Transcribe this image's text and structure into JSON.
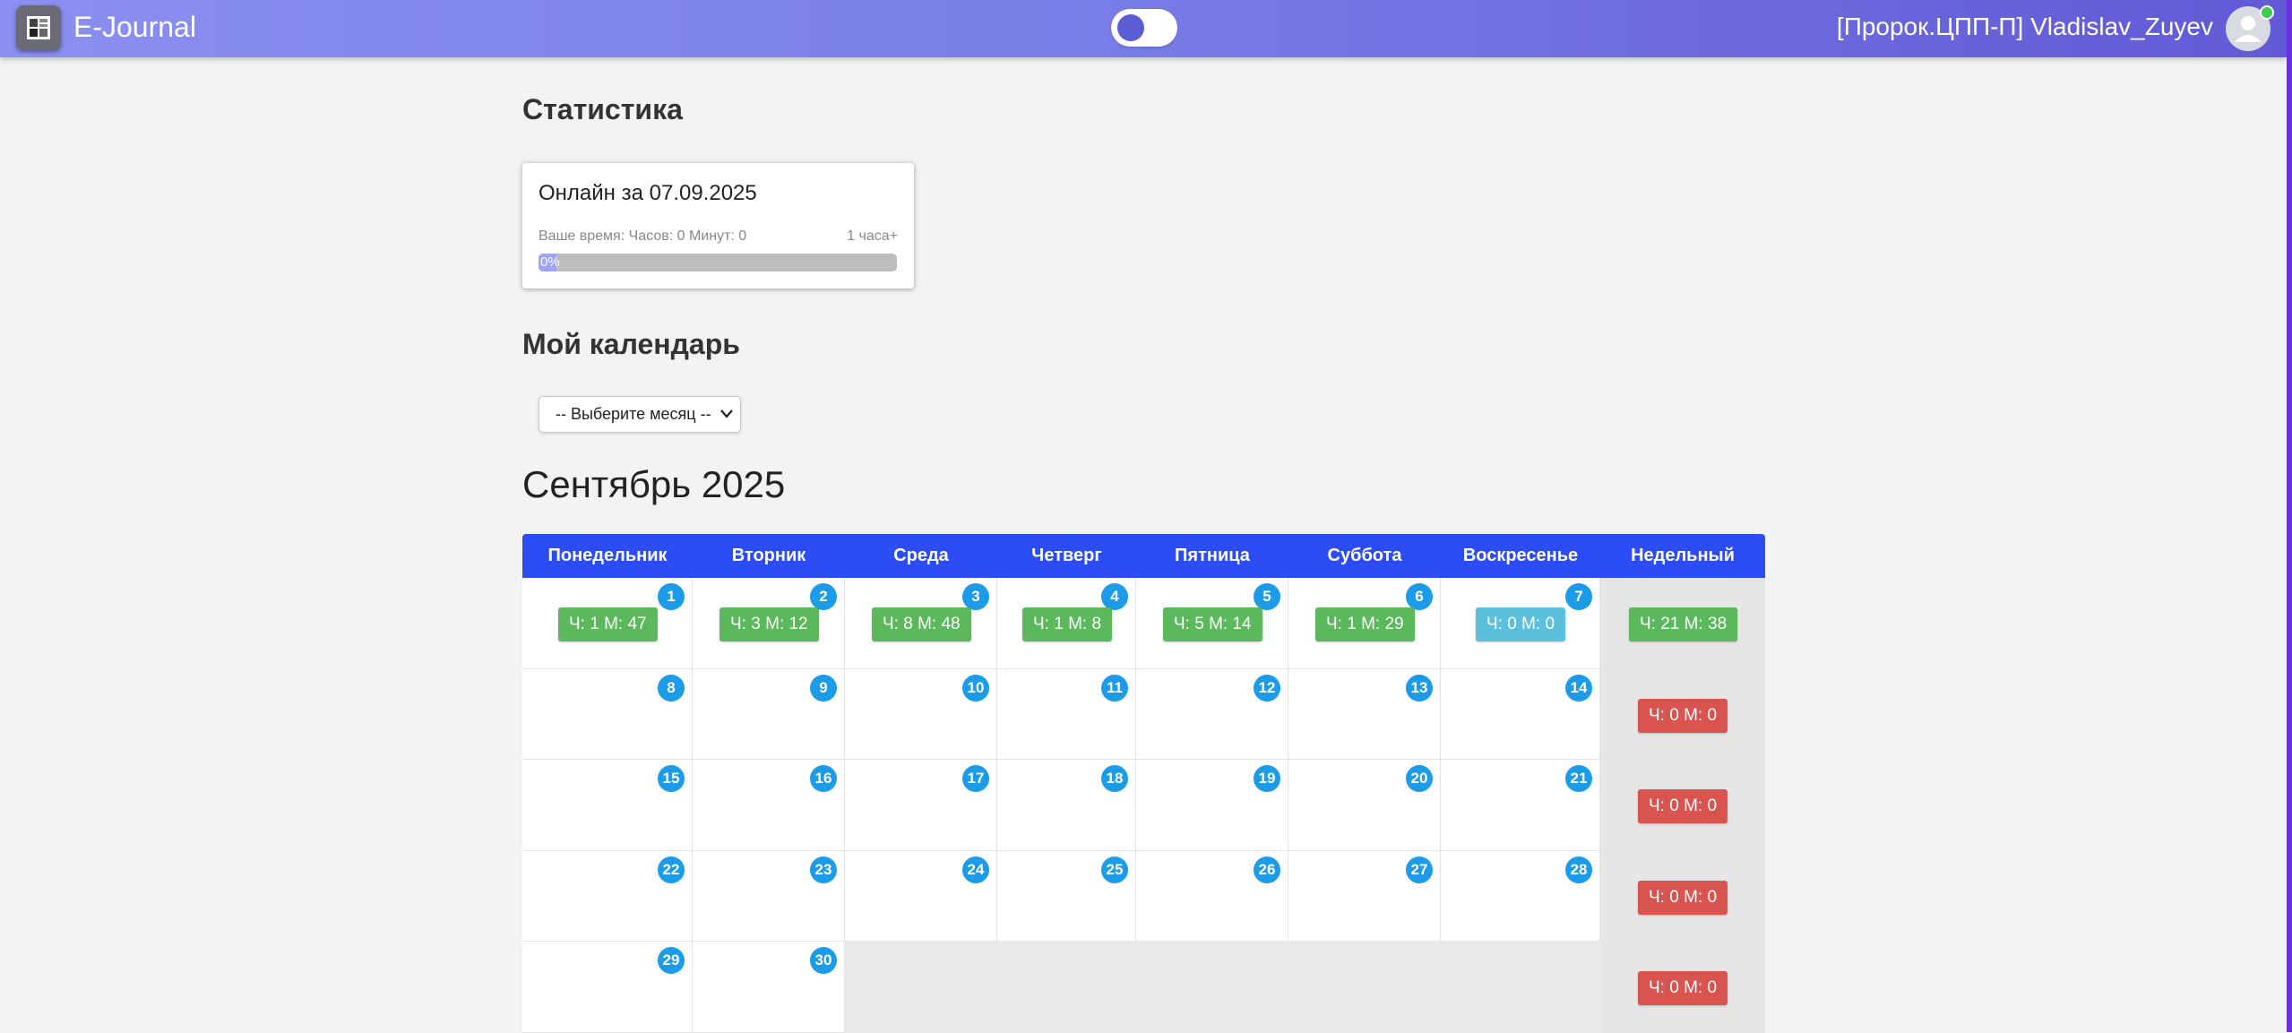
{
  "header": {
    "app_title": "E-Journal",
    "user": "[Пророк.ЦПП-П] Vladislav_Zuyev",
    "logo_icon": "journal-logo-icon",
    "avatar_icon": "user-avatar-icon",
    "theme_toggle": "on"
  },
  "stats": {
    "heading": "Статистика",
    "card_title": "Онлайн за 07.09.2025",
    "time_label": "Ваше время: Часов: 0 Минут: 0",
    "goal_label": "1 часа+",
    "progress_label": "0%",
    "progress_value": 0.05
  },
  "calendar": {
    "heading": "Мой календарь",
    "select_placeholder": "-- Выберите месяц --",
    "month_title": "Сентябрь 2025",
    "weekdays": [
      "Понедельник",
      "Вторник",
      "Среда",
      "Четверг",
      "Пятница",
      "Суббота",
      "Воскресенье",
      "Недельный"
    ],
    "weeks": [
      {
        "days": [
          {
            "num": "1",
            "time": "Ч: 1 М: 47",
            "status": "green"
          },
          {
            "num": "2",
            "time": "Ч: 3 М: 12",
            "status": "green"
          },
          {
            "num": "3",
            "time": "Ч: 8 М: 48",
            "status": "green"
          },
          {
            "num": "4",
            "time": "Ч: 1 М: 8",
            "status": "green"
          },
          {
            "num": "5",
            "time": "Ч: 5 М: 14",
            "status": "green"
          },
          {
            "num": "6",
            "time": "Ч: 1 М: 29",
            "status": "green"
          },
          {
            "num": "7",
            "time": "Ч: 0 М: 0",
            "status": "blue"
          }
        ],
        "total": {
          "time": "Ч: 21 М: 38",
          "status": "green"
        }
      },
      {
        "days": [
          {
            "num": "8"
          },
          {
            "num": "9"
          },
          {
            "num": "10"
          },
          {
            "num": "11"
          },
          {
            "num": "12"
          },
          {
            "num": "13"
          },
          {
            "num": "14"
          }
        ],
        "total": {
          "time": "Ч: 0 М: 0",
          "status": "red"
        }
      },
      {
        "days": [
          {
            "num": "15"
          },
          {
            "num": "16"
          },
          {
            "num": "17"
          },
          {
            "num": "18"
          },
          {
            "num": "19"
          },
          {
            "num": "20"
          },
          {
            "num": "21"
          }
        ],
        "total": {
          "time": "Ч: 0 М: 0",
          "status": "red"
        }
      },
      {
        "days": [
          {
            "num": "22"
          },
          {
            "num": "23"
          },
          {
            "num": "24"
          },
          {
            "num": "25"
          },
          {
            "num": "26"
          },
          {
            "num": "27"
          },
          {
            "num": "28"
          }
        ],
        "total": {
          "time": "Ч: 0 М: 0",
          "status": "red"
        }
      },
      {
        "days": [
          {
            "num": "29"
          },
          {
            "num": "30"
          },
          {},
          {},
          {},
          {},
          {}
        ],
        "total": {
          "time": "Ч: 0 М: 0",
          "status": "red"
        }
      }
    ],
    "colors": {
      "green": "#5cb85c",
      "blue": "#5bc0de",
      "red": "#d9534f",
      "header": "#2c4cf5",
      "badge": "#1b9be8"
    }
  }
}
